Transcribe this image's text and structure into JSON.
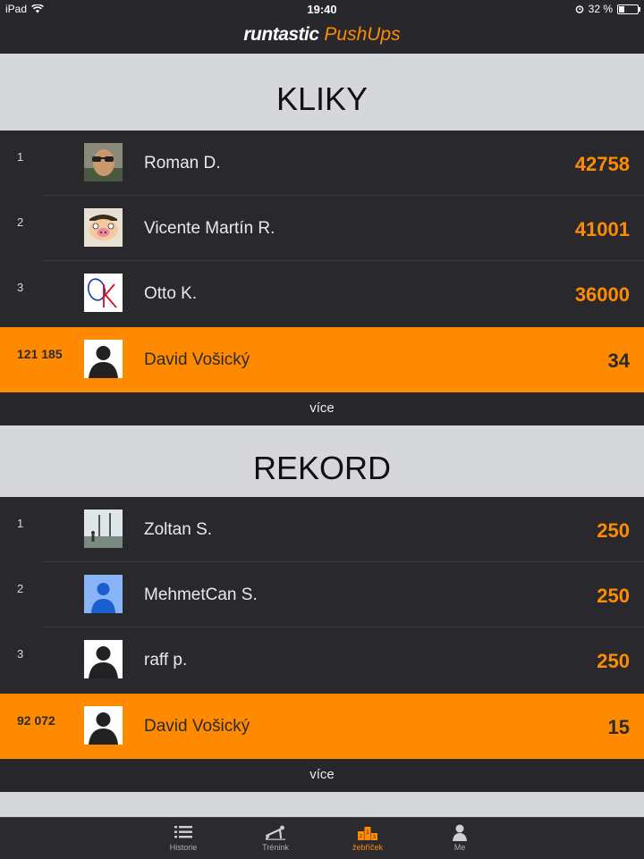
{
  "status_bar": {
    "carrier": "iPad",
    "time": "19:40",
    "battery": "32 %",
    "battery_level": 0.32
  },
  "header": {
    "brand": "runtastic",
    "app_name": "PushUps"
  },
  "sections": [
    {
      "title": "KLIKY",
      "rows": [
        {
          "rank": "1",
          "name": "Roman D.",
          "score": "42758",
          "avatar": "photo-sunglasses"
        },
        {
          "rank": "2",
          "name": "Vicente Martín R.",
          "score": "41001",
          "avatar": "cartoon-pig"
        },
        {
          "rank": "3",
          "name": "Otto K.",
          "score": "36000",
          "avatar": "ok-logo"
        }
      ],
      "me": {
        "rank": "121 185",
        "name": "David Vošický",
        "score": "34",
        "avatar": "silhouette"
      },
      "more_label": "více"
    },
    {
      "title": "REKORD",
      "rows": [
        {
          "rank": "1",
          "name": "Zoltan S.",
          "score": "250",
          "avatar": "photo-landscape"
        },
        {
          "rank": "2",
          "name": "MehmetCan S.",
          "score": "250",
          "avatar": "blue-person"
        },
        {
          "rank": "3",
          "name": "raff p.",
          "score": "250",
          "avatar": "silhouette"
        }
      ],
      "me": {
        "rank": "92 072",
        "name": "David Vošický",
        "score": "15",
        "avatar": "silhouette"
      },
      "more_label": "více"
    }
  ],
  "tabs": [
    {
      "label": "Historie",
      "icon": "list-icon",
      "active": false
    },
    {
      "label": "Trénink",
      "icon": "pushup-icon",
      "active": false
    },
    {
      "label": "žebříček",
      "icon": "podium-icon",
      "active": true
    },
    {
      "label": "Me",
      "icon": "profile-icon",
      "active": false
    }
  ],
  "colors": {
    "accent": "#ff8a00",
    "row_bg": "#29292d",
    "header_bg": "#d6d7db"
  }
}
